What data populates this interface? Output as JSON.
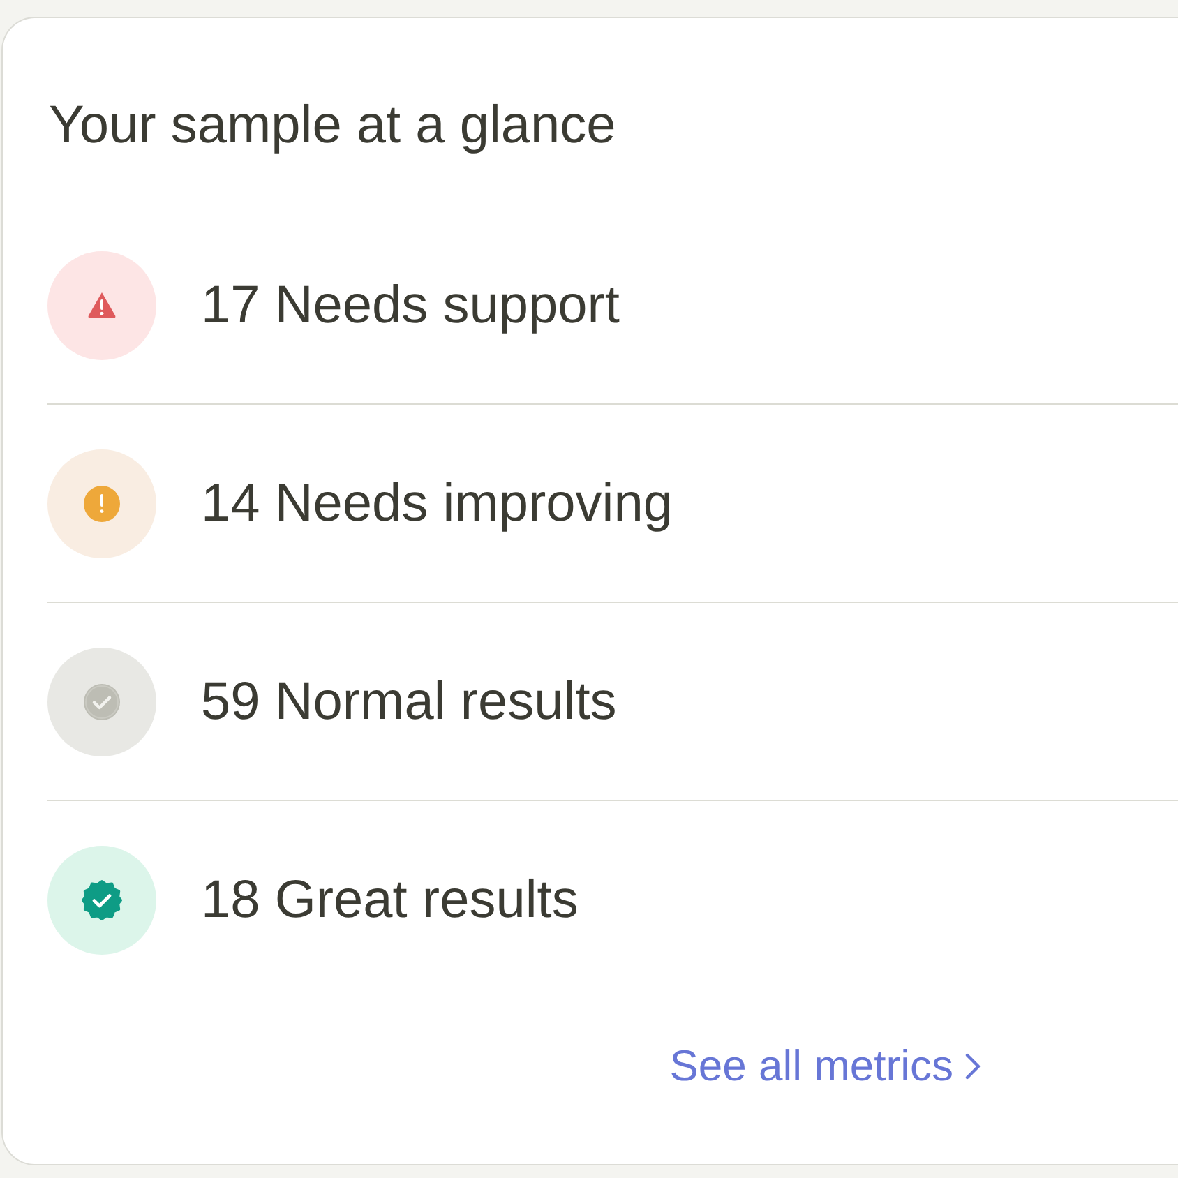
{
  "card": {
    "title": "Your sample at a glance",
    "results": [
      {
        "kind": "warning",
        "text": "17 Needs support"
      },
      {
        "kind": "caution",
        "text": "14 Needs improving"
      },
      {
        "kind": "normal",
        "text": "59 Normal results"
      },
      {
        "kind": "great",
        "text": "18 Great results"
      }
    ],
    "link": {
      "label": "See all metrics"
    }
  }
}
